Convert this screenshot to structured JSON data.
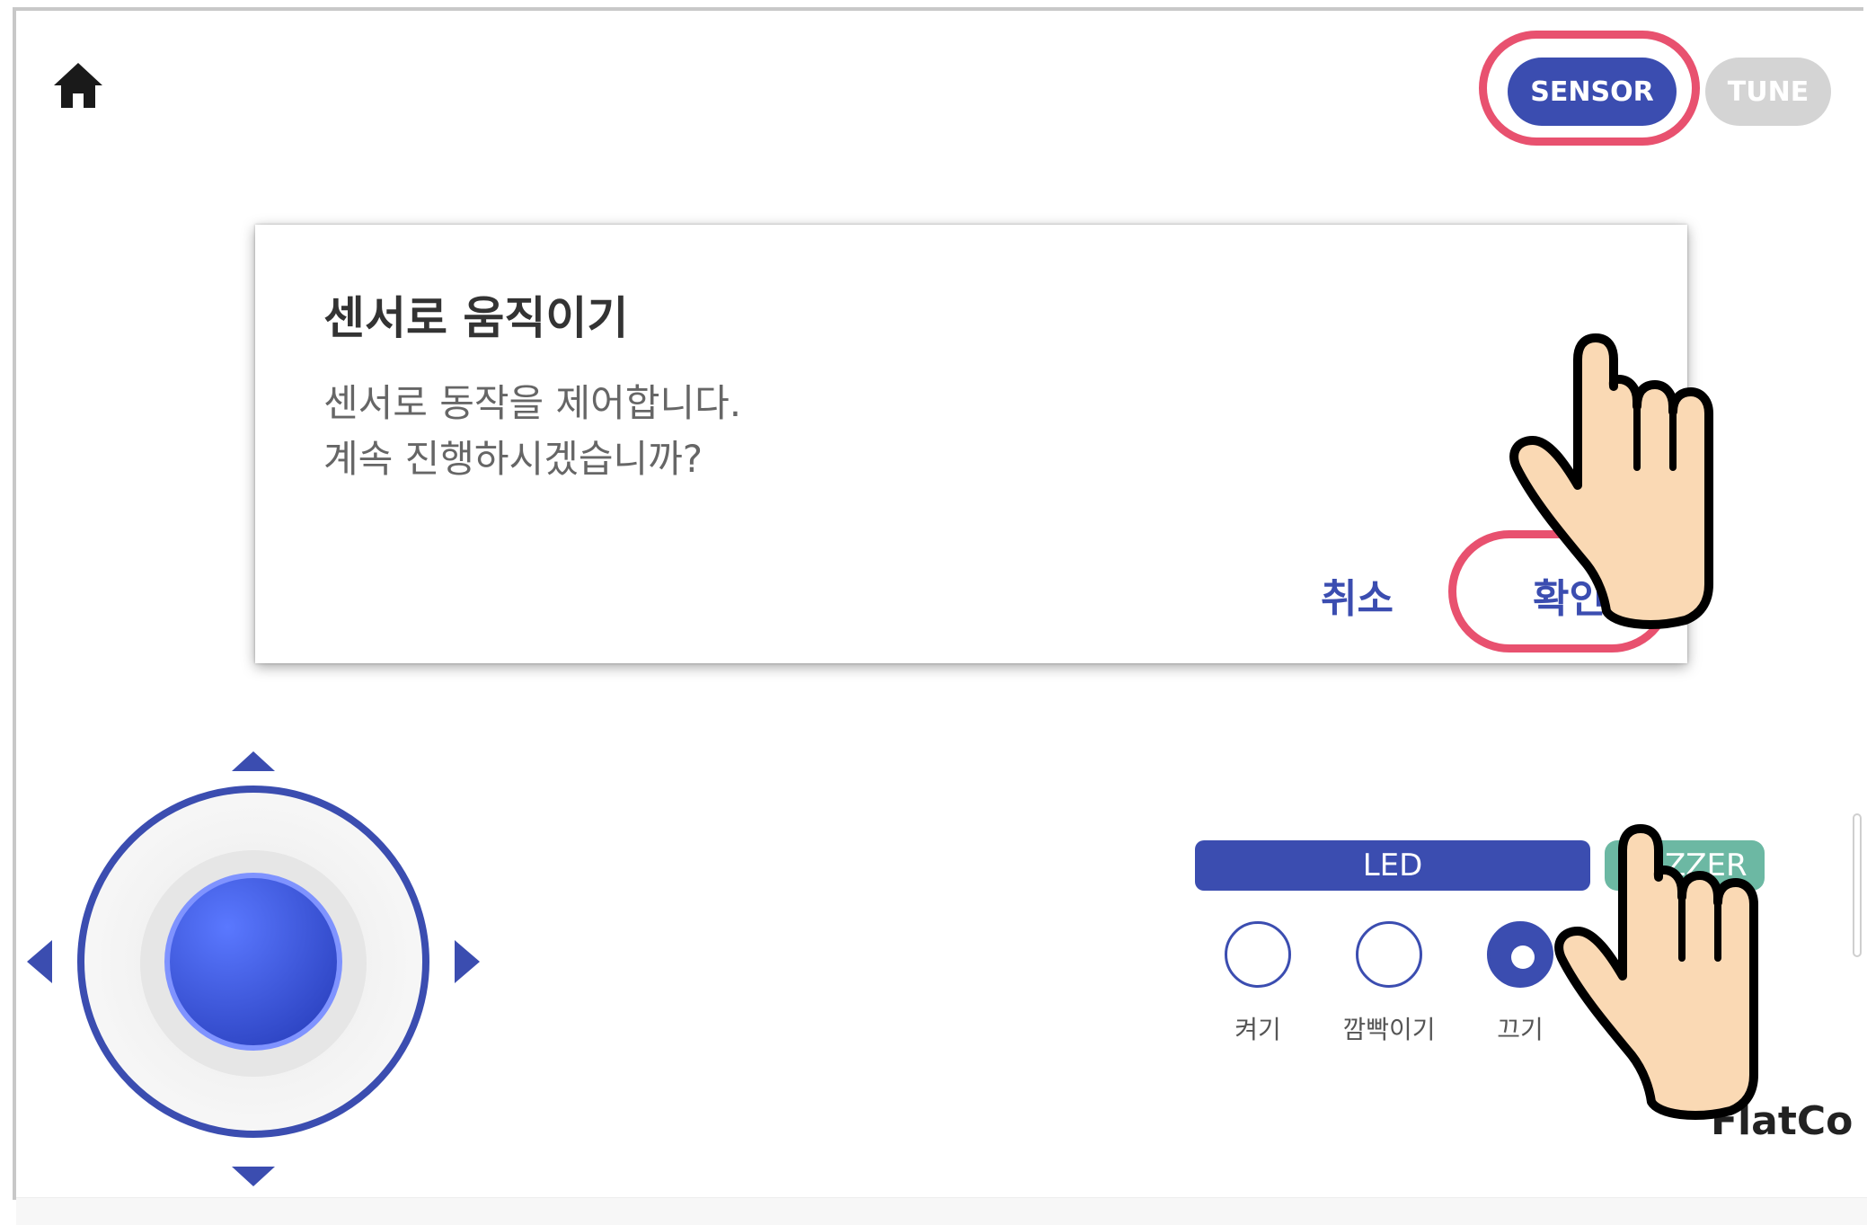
{
  "header": {
    "home_icon": "home-icon",
    "mode_buttons": {
      "sensor": "SENSOR",
      "tune": "TUNE"
    }
  },
  "dialog": {
    "title": "센서로 움직이기",
    "message_line1": "센서로 동작을 제어합니다.",
    "message_line2": "계속 진행하시겠습니까?",
    "cancel": "취소",
    "confirm": "확인"
  },
  "joystick": {
    "arrows": [
      "up-arrow-icon",
      "down-arrow-icon",
      "left-arrow-icon",
      "right-arrow-icon"
    ]
  },
  "controls": {
    "tabs": {
      "led": "LED",
      "buzzer": "BUZZER"
    },
    "led_options": [
      "켜기",
      "깜빡이기",
      "끄기"
    ],
    "selected_option": "끄기"
  },
  "brand": {
    "logo": "FlatCo"
  },
  "colors": {
    "accent": "#3b4db0",
    "highlight": "#e8516f",
    "buzzer_tab": "#6cb8a3",
    "inactive": "#d4d4d4"
  }
}
